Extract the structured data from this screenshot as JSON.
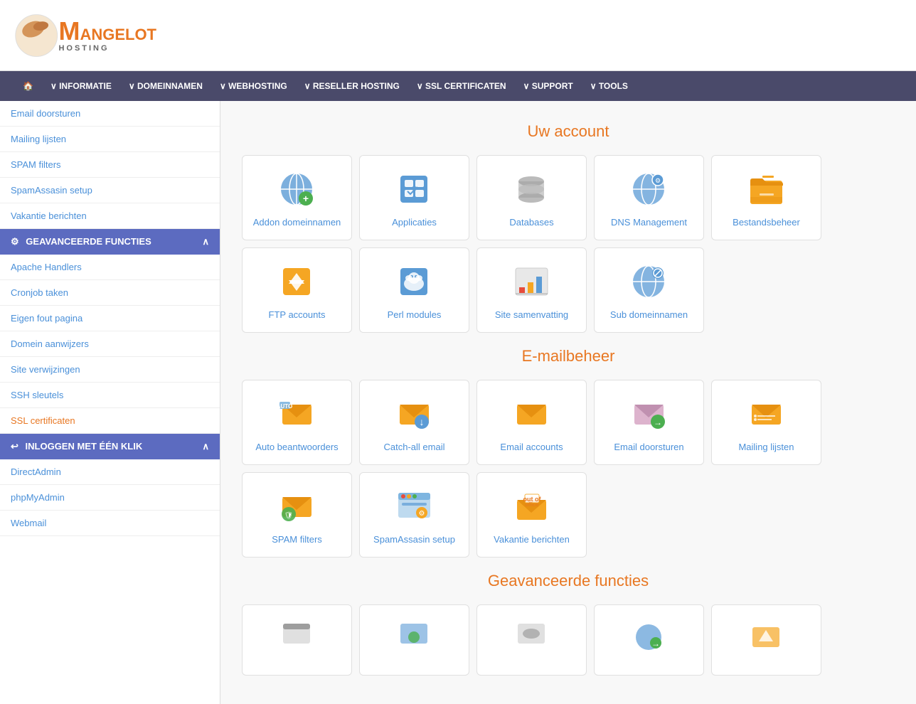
{
  "logo": {
    "m": "M",
    "angelot": "ANGELOT",
    "hosting": "HOSTING"
  },
  "nav": {
    "home_label": "🏠",
    "items": [
      {
        "label": "∨ INFORMATIE"
      },
      {
        "label": "∨ DOMEINNAMEN"
      },
      {
        "label": "∨ WEBHOSTING"
      },
      {
        "label": "∨ RESELLER HOSTING"
      },
      {
        "label": "∨ SSL CERTIFICATEN"
      },
      {
        "label": "∨ SUPPORT"
      },
      {
        "label": "∨ TOOLS"
      }
    ]
  },
  "sidebar": {
    "email_items": [
      {
        "label": "Email doorsturen"
      },
      {
        "label": "Mailing lijsten"
      },
      {
        "label": "SPAM filters"
      },
      {
        "label": "SpamAssasin setup"
      },
      {
        "label": "Vakantie berichten"
      }
    ],
    "advanced_header": "GEAVANCEERDE FUNCTIES",
    "advanced_items": [
      {
        "label": "Apache Handlers"
      },
      {
        "label": "Cronjob taken"
      },
      {
        "label": "Eigen fout pagina"
      },
      {
        "label": "Domein aanwijzers"
      },
      {
        "label": "Site verwijzingen"
      },
      {
        "label": "SSH sleutels"
      },
      {
        "label": "SSL certificaten"
      }
    ],
    "login_header": "INLOGGEN MET ÉÉN KLIK",
    "login_items": [
      {
        "label": "DirectAdmin"
      },
      {
        "label": "phpMyAdmin"
      },
      {
        "label": "Webmail"
      }
    ]
  },
  "main": {
    "account_title": "Uw account",
    "account_tiles": [
      {
        "label": "Addon domeinnamen",
        "icon": "addon-domain"
      },
      {
        "label": "Applicaties",
        "icon": "applicaties"
      },
      {
        "label": "Databases",
        "icon": "databases"
      },
      {
        "label": "DNS Management",
        "icon": "dns"
      },
      {
        "label": "Bestandsbeheer",
        "icon": "bestandsbeheer"
      },
      {
        "label": "FTP accounts",
        "icon": "ftp"
      },
      {
        "label": "Perl modules",
        "icon": "perl"
      },
      {
        "label": "Site samenvatting",
        "icon": "site-summary"
      },
      {
        "label": "Sub domeinnamen",
        "icon": "subdomain"
      }
    ],
    "email_title": "E-mailbeheer",
    "email_tiles": [
      {
        "label": "Auto beantwoorders",
        "icon": "auto-reply"
      },
      {
        "label": "Catch-all email",
        "icon": "catch-all"
      },
      {
        "label": "Email accounts",
        "icon": "email-accounts"
      },
      {
        "label": "Email doorsturen",
        "icon": "email-forward"
      },
      {
        "label": "Mailing lijsten",
        "icon": "mailing-list"
      },
      {
        "label": "SPAM filters",
        "icon": "spam"
      },
      {
        "label": "SpamAssasin setup",
        "icon": "spamassasin"
      },
      {
        "label": "Vakantie berichten",
        "icon": "vacation"
      }
    ],
    "advanced_title": "Geavanceerde functies"
  }
}
